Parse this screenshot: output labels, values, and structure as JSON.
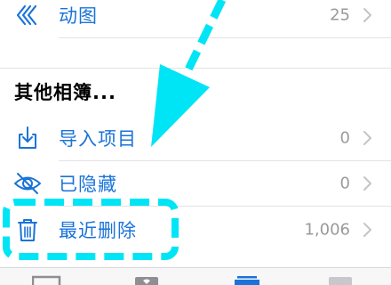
{
  "albums": {
    "row_animated": {
      "label": "动图",
      "count": "25",
      "icon": "animated-icon"
    },
    "section_title": "其他相簿...",
    "row_imports": {
      "label": "导入项目",
      "count": "0",
      "icon": "import-icon"
    },
    "row_hidden": {
      "label": "已隐藏",
      "count": "0",
      "icon": "hidden-eye-icon"
    },
    "row_deleted": {
      "label": "最近删除",
      "count": "1,006",
      "icon": "trash-icon"
    }
  },
  "tabbar": {
    "tabs": [
      "photos-tab-icon",
      "for-you-tab-icon",
      "albums-tab-icon",
      "search-tab-icon"
    ],
    "active_index": 2
  },
  "annotation": {
    "arrow_color": "#00e5f5",
    "highlight_color": "#00e5f5"
  },
  "colors": {
    "accent": "#1a73d9",
    "muted": "#9a9a9a"
  }
}
